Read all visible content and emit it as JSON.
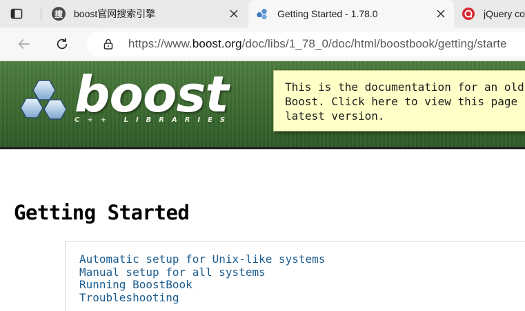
{
  "browser": {
    "tabs": [
      {
        "title": "boost官网搜索引擎",
        "favicon": "sou-search-favicon-icon",
        "favicon_glyph": "搜"
      },
      {
        "title": "Getting Started - 1.78.0",
        "favicon": "boost-favicon-icon",
        "active": true
      },
      {
        "title": "jQuery co",
        "favicon": "jquery-red-favicon-icon"
      }
    ],
    "url_prefix": "https://www.",
    "url_host": "boost.org",
    "url_path": "/doc/libs/1_78_0/doc/html/boostbook/getting/starte"
  },
  "header": {
    "logo_word": "boost",
    "logo_subtitle": "C++ LIBRARIES",
    "notice": "This is the documentation for an old\nBoost. Click here to view this page \nlatest version."
  },
  "content": {
    "title": "Getting Started",
    "toc": [
      "Automatic setup for Unix-like systems",
      "Manual setup for all systems",
      "Running BoostBook",
      "Troubleshooting"
    ]
  },
  "colors": {
    "banner_green": "#3f6e33",
    "notice_yellow": "#ffffc8",
    "link_blue": "#1a5c8f"
  }
}
